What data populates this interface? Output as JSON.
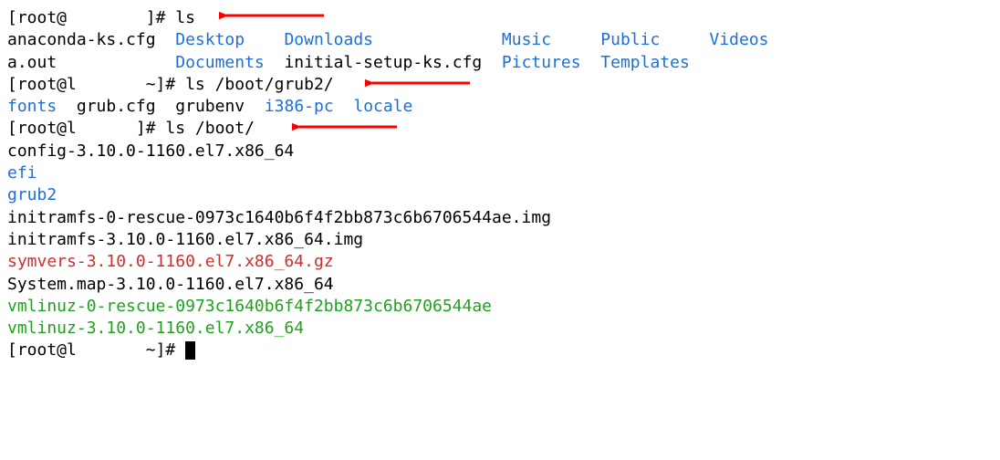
{
  "prompt1_a": "[root@",
  "prompt1_b": "]# ",
  "cmd1": "ls",
  "ls_root": {
    "anaconda": "anaconda-ks.cfg",
    "desktop": "Desktop",
    "downloads": "Downloads",
    "music": "Music",
    "public": "Public",
    "videos": "Videos",
    "aout": "a.out",
    "documents": "Documents",
    "initial": "initial-setup-ks.cfg",
    "pictures": "Pictures",
    "templates": "Templates"
  },
  "prompt2_a": "[root@l",
  "prompt2_b": "~]# ",
  "cmd2": "ls /boot/grub2/",
  "grub2": {
    "fonts": "fonts",
    "grubcfg": "grub.cfg",
    "grubenv": "grubenv",
    "i386pc": "i386-pc",
    "locale": "locale"
  },
  "prompt3_a": "[root@l",
  "prompt3_b": "]# ",
  "cmd3": "ls /boot/",
  "boot": {
    "config": "config-3.10.0-1160.el7.x86_64",
    "efi": "efi",
    "grub2": "grub2",
    "initramfs_rescue": "initramfs-0-rescue-0973c1640b6f4f2bb873c6b6706544ae.img",
    "initramfs": "initramfs-3.10.0-1160.el7.x86_64.img",
    "symvers": "symvers-3.10.0-1160.el7.x86_64.gz",
    "systemmap": "System.map-3.10.0-1160.el7.x86_64",
    "vmlinuz_rescue": "vmlinuz-0-rescue-0973c1640b6f4f2bb873c6b6706544ae",
    "vmlinuz": "vmlinuz-3.10.0-1160.el7.x86_64"
  },
  "prompt4_a": "[root@l",
  "prompt4_b": " ~]# "
}
